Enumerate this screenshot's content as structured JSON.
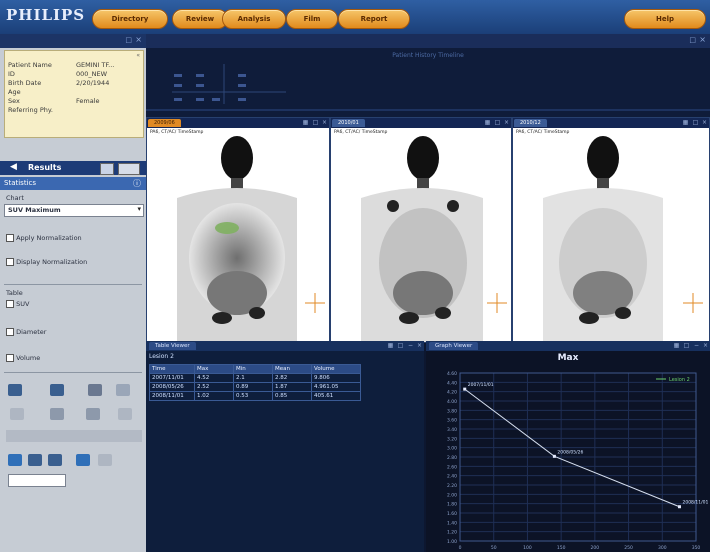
{
  "app": {
    "logo": "PHILIPS"
  },
  "nav": {
    "buttons": [
      "Directory",
      "Review",
      "Analysis",
      "Film",
      "Report"
    ],
    "help": "Help"
  },
  "patient": {
    "rows": [
      {
        "label": "Patient Name",
        "value": "GEMINI TF..."
      },
      {
        "label": "ID",
        "value": "000_NEW"
      },
      {
        "label": "Birth Date",
        "value": "2/20/1944"
      },
      {
        "label": "Age",
        "value": ""
      },
      {
        "label": "Sex",
        "value": "Female"
      },
      {
        "label": "Referring Phy.",
        "value": ""
      }
    ]
  },
  "results": {
    "label": "Results"
  },
  "statistics": {
    "title": "Statistics",
    "chart_label": "Chart",
    "chart_value": "SUV Maximum",
    "checks": [
      "Apply Normalization",
      "Display Normalization"
    ],
    "table_label": "Table",
    "table_checks": [
      "SUV",
      "Diameter",
      "Volume"
    ]
  },
  "strip": {
    "title": "Patient History Timeline"
  },
  "viewports": [
    {
      "tab": "2009/06",
      "active": true,
      "title": "PA6, CT/AC/ TimeStamp"
    },
    {
      "tab": "2010/01",
      "active": false,
      "title": "PA6, CT/AC/ TimeStamp"
    },
    {
      "tab": "2010/12",
      "active": false,
      "title": "PA6, CT/AC/ TimeStamp"
    }
  ],
  "table_viewer": {
    "tab": "Table Viewer",
    "subtitle": "Lesion 2",
    "headers": [
      "Time",
      "Max",
      "Min",
      "Mean",
      "Volume"
    ],
    "rows": [
      [
        "2007/11/01",
        "4.52",
        "2.1",
        "2.82",
        "9.806"
      ],
      [
        "2008/05/26",
        "2.52",
        "0.89",
        "1.87",
        "4.961.05"
      ],
      [
        "2008/11/01",
        "1.02",
        "0.53",
        "0.85",
        "405.61"
      ]
    ]
  },
  "graph_viewer": {
    "tab": "Graph Viewer",
    "title": "Max",
    "legend": "Lesion 2"
  },
  "chart_data": {
    "type": "line",
    "title": "Max",
    "x": [
      "2007/11/01",
      "2008/05/26",
      "2008/11/01"
    ],
    "series": [
      {
        "name": "Lesion 2",
        "values": [
          4.52,
          2.52,
          1.02
        ]
      }
    ],
    "ylim": [
      0,
      5
    ],
    "yticks": [
      "4.60",
      "4.40",
      "4.20",
      "4.00",
      "3.80",
      "3.60",
      "3.40",
      "3.20",
      "3.00",
      "2.80",
      "2.60",
      "2.40",
      "2.20",
      "2.00",
      "1.80",
      "1.60",
      "1.40",
      "1.20",
      "1.00"
    ],
    "xticks": [
      "0",
      "50",
      "100",
      "150",
      "200",
      "250",
      "300",
      "350"
    ],
    "grid": true,
    "legend_position": "top-right"
  }
}
